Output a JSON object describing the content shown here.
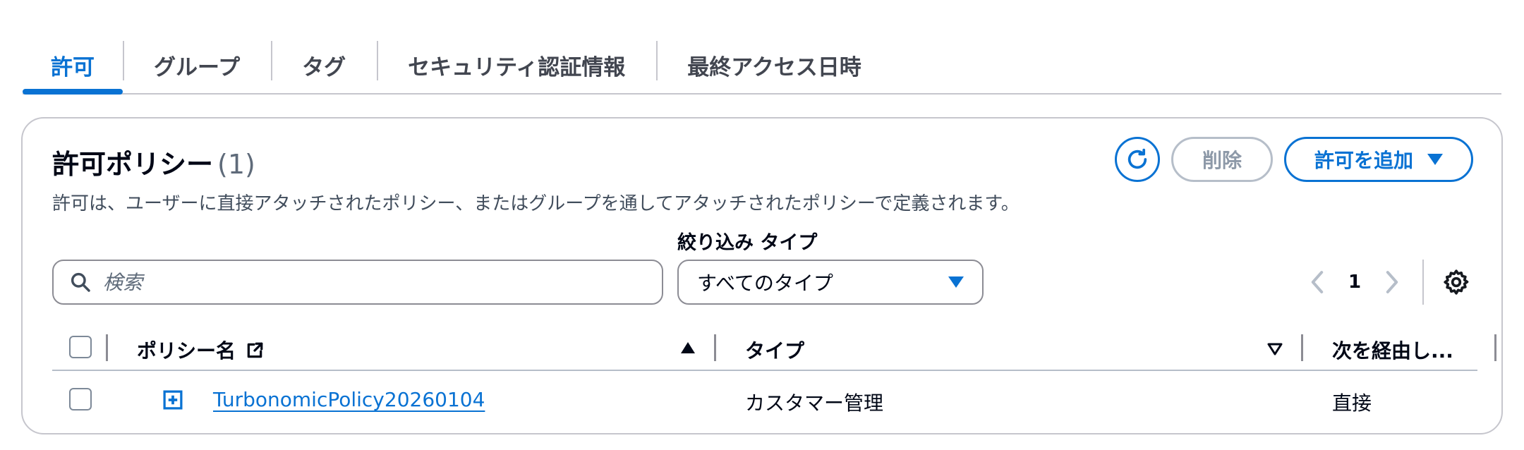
{
  "tabs": [
    {
      "label": "許可",
      "active": true
    },
    {
      "label": "グループ"
    },
    {
      "label": "タグ"
    },
    {
      "label": "セキュリティ認証情報"
    },
    {
      "label": "最終アクセス日時"
    }
  ],
  "panel": {
    "title": "許可ポリシー",
    "count": "(1)",
    "description": "許可は、ユーザーに直接アタッチされたポリシー、またはグループを通してアタッチされたポリシーで定義されます。",
    "delete_label": "削除",
    "add_label": "許可を追加"
  },
  "filter": {
    "search_placeholder": "検索",
    "type_label": "絞り込み タイプ",
    "type_selected": "すべてのタイプ"
  },
  "pagination": {
    "page": "1"
  },
  "table": {
    "columns": [
      "ポリシー名",
      "タイプ",
      "次を経由し..."
    ],
    "rows": [
      {
        "name": "TurbonomicPolicy20260104",
        "type": "カスタマー管理",
        "via": "直接"
      }
    ]
  },
  "colors": {
    "accent": "#0972d3",
    "disabled": "#8d99a8",
    "border": "#c6c6cd"
  }
}
